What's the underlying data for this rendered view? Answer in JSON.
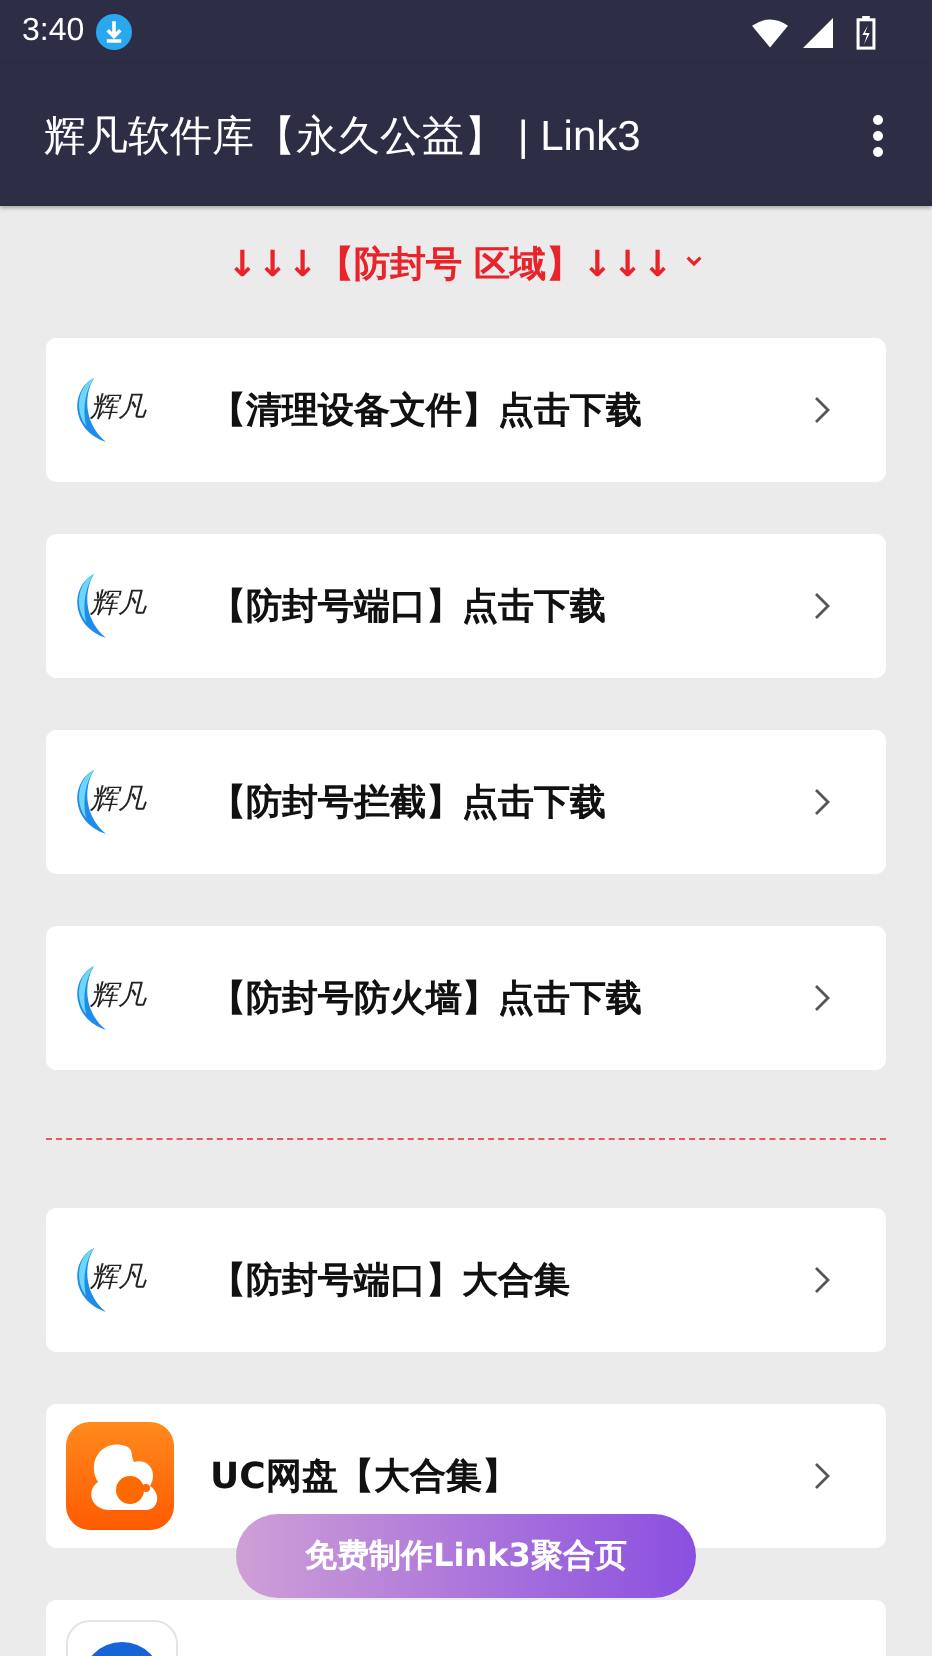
{
  "status_bar": {
    "time": "3:40"
  },
  "app_bar": {
    "title": "辉凡软件库【永久公益】 | Link3"
  },
  "section_header": {
    "title": "↓↓↓【防封号 区域】↓↓↓",
    "expanded": true
  },
  "items": [
    {
      "kind": "huifan",
      "logo_text": "辉凡",
      "label": "【清理设备文件】点击下载"
    },
    {
      "kind": "huifan",
      "logo_text": "辉凡",
      "label": "【防封号端口】点击下载"
    },
    {
      "kind": "huifan",
      "logo_text": "辉凡",
      "label": "【防封号拦截】点击下载"
    },
    {
      "kind": "huifan",
      "logo_text": "辉凡",
      "label": "【防封号防火墙】点击下载"
    },
    {
      "kind": "divider"
    },
    {
      "kind": "huifan",
      "logo_text": "辉凡",
      "label": "【防封号端口】大合集"
    },
    {
      "kind": "uc",
      "label": "UC网盘【大合集】"
    },
    {
      "kind": "blue"
    }
  ],
  "floating_button": {
    "label": "免费制作Link3聚合页"
  }
}
